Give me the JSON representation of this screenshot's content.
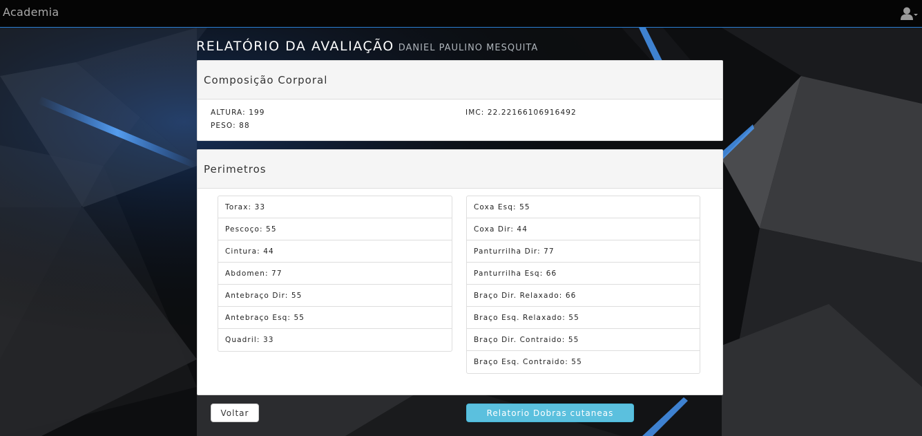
{
  "navbar": {
    "brand": "Academia"
  },
  "header": {
    "title": "RELATÓRIO DA AVALIAÇÃO",
    "subtitle": "DANIEL PAULINO MESQUITA"
  },
  "composicao": {
    "heading": "Composição Corporal",
    "altura": "ALTURA: 199",
    "peso": "PESO: 88",
    "imc": "IMC: 22.22166106916492"
  },
  "perimetros": {
    "heading": "Perimetros",
    "left": [
      "Torax: 33",
      "Pescoço: 55",
      "Cintura: 44",
      "Abdomen: 77",
      "Antebraço Dir: 55",
      "Antebraço Esq: 55",
      "Quadril: 33"
    ],
    "right": [
      "Coxa Esq: 55",
      "Coxa Dir: 44",
      "Panturrilha Dir: 77",
      "Panturrilha Esq: 66",
      "Braço Dir. Relaxado: 66",
      "Braço Esq. Relaxado: 55",
      "Braço Dir. Contraido: 55",
      "Braço Esq. Contraido: 55"
    ]
  },
  "buttons": {
    "back": "Voltar",
    "skinfold_report": "Relatorio Dobras cutaneas"
  },
  "icons": {
    "user": "user-icon",
    "caret": "caret-down-icon"
  },
  "colors": {
    "accent": "#2a7fd4",
    "info_button": "#5bc0de",
    "brand_text": "#a9a9a9"
  }
}
